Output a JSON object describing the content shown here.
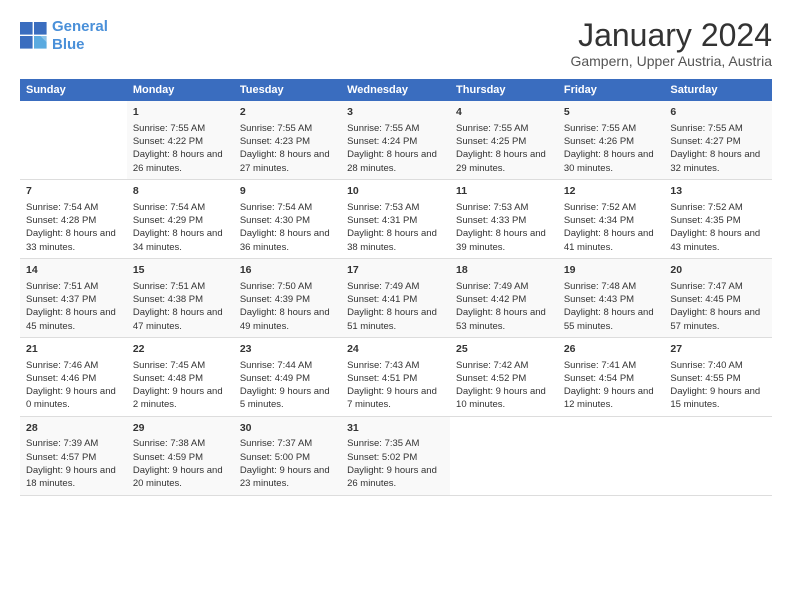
{
  "logo": {
    "line1": "General",
    "line2": "Blue"
  },
  "title": "January 2024",
  "location": "Gampern, Upper Austria, Austria",
  "days_of_week": [
    "Sunday",
    "Monday",
    "Tuesday",
    "Wednesday",
    "Thursday",
    "Friday",
    "Saturday"
  ],
  "weeks": [
    [
      {
        "day": "",
        "sunrise": "",
        "sunset": "",
        "daylight": ""
      },
      {
        "day": "1",
        "sunrise": "7:55 AM",
        "sunset": "4:22 PM",
        "daylight": "8 hours and 26 minutes."
      },
      {
        "day": "2",
        "sunrise": "7:55 AM",
        "sunset": "4:23 PM",
        "daylight": "8 hours and 27 minutes."
      },
      {
        "day": "3",
        "sunrise": "7:55 AM",
        "sunset": "4:24 PM",
        "daylight": "8 hours and 28 minutes."
      },
      {
        "day": "4",
        "sunrise": "7:55 AM",
        "sunset": "4:25 PM",
        "daylight": "8 hours and 29 minutes."
      },
      {
        "day": "5",
        "sunrise": "7:55 AM",
        "sunset": "4:26 PM",
        "daylight": "8 hours and 30 minutes."
      },
      {
        "day": "6",
        "sunrise": "7:55 AM",
        "sunset": "4:27 PM",
        "daylight": "8 hours and 32 minutes."
      }
    ],
    [
      {
        "day": "7",
        "sunrise": "7:54 AM",
        "sunset": "4:28 PM",
        "daylight": "8 hours and 33 minutes."
      },
      {
        "day": "8",
        "sunrise": "7:54 AM",
        "sunset": "4:29 PM",
        "daylight": "8 hours and 34 minutes."
      },
      {
        "day": "9",
        "sunrise": "7:54 AM",
        "sunset": "4:30 PM",
        "daylight": "8 hours and 36 minutes."
      },
      {
        "day": "10",
        "sunrise": "7:53 AM",
        "sunset": "4:31 PM",
        "daylight": "8 hours and 38 minutes."
      },
      {
        "day": "11",
        "sunrise": "7:53 AM",
        "sunset": "4:33 PM",
        "daylight": "8 hours and 39 minutes."
      },
      {
        "day": "12",
        "sunrise": "7:52 AM",
        "sunset": "4:34 PM",
        "daylight": "8 hours and 41 minutes."
      },
      {
        "day": "13",
        "sunrise": "7:52 AM",
        "sunset": "4:35 PM",
        "daylight": "8 hours and 43 minutes."
      }
    ],
    [
      {
        "day": "14",
        "sunrise": "7:51 AM",
        "sunset": "4:37 PM",
        "daylight": "8 hours and 45 minutes."
      },
      {
        "day": "15",
        "sunrise": "7:51 AM",
        "sunset": "4:38 PM",
        "daylight": "8 hours and 47 minutes."
      },
      {
        "day": "16",
        "sunrise": "7:50 AM",
        "sunset": "4:39 PM",
        "daylight": "8 hours and 49 minutes."
      },
      {
        "day": "17",
        "sunrise": "7:49 AM",
        "sunset": "4:41 PM",
        "daylight": "8 hours and 51 minutes."
      },
      {
        "day": "18",
        "sunrise": "7:49 AM",
        "sunset": "4:42 PM",
        "daylight": "8 hours and 53 minutes."
      },
      {
        "day": "19",
        "sunrise": "7:48 AM",
        "sunset": "4:43 PM",
        "daylight": "8 hours and 55 minutes."
      },
      {
        "day": "20",
        "sunrise": "7:47 AM",
        "sunset": "4:45 PM",
        "daylight": "8 hours and 57 minutes."
      }
    ],
    [
      {
        "day": "21",
        "sunrise": "7:46 AM",
        "sunset": "4:46 PM",
        "daylight": "9 hours and 0 minutes."
      },
      {
        "day": "22",
        "sunrise": "7:45 AM",
        "sunset": "4:48 PM",
        "daylight": "9 hours and 2 minutes."
      },
      {
        "day": "23",
        "sunrise": "7:44 AM",
        "sunset": "4:49 PM",
        "daylight": "9 hours and 5 minutes."
      },
      {
        "day": "24",
        "sunrise": "7:43 AM",
        "sunset": "4:51 PM",
        "daylight": "9 hours and 7 minutes."
      },
      {
        "day": "25",
        "sunrise": "7:42 AM",
        "sunset": "4:52 PM",
        "daylight": "9 hours and 10 minutes."
      },
      {
        "day": "26",
        "sunrise": "7:41 AM",
        "sunset": "4:54 PM",
        "daylight": "9 hours and 12 minutes."
      },
      {
        "day": "27",
        "sunrise": "7:40 AM",
        "sunset": "4:55 PM",
        "daylight": "9 hours and 15 minutes."
      }
    ],
    [
      {
        "day": "28",
        "sunrise": "7:39 AM",
        "sunset": "4:57 PM",
        "daylight": "9 hours and 18 minutes."
      },
      {
        "day": "29",
        "sunrise": "7:38 AM",
        "sunset": "4:59 PM",
        "daylight": "9 hours and 20 minutes."
      },
      {
        "day": "30",
        "sunrise": "7:37 AM",
        "sunset": "5:00 PM",
        "daylight": "9 hours and 23 minutes."
      },
      {
        "day": "31",
        "sunrise": "7:35 AM",
        "sunset": "5:02 PM",
        "daylight": "9 hours and 26 minutes."
      },
      {
        "day": "",
        "sunrise": "",
        "sunset": "",
        "daylight": ""
      },
      {
        "day": "",
        "sunrise": "",
        "sunset": "",
        "daylight": ""
      },
      {
        "day": "",
        "sunrise": "",
        "sunset": "",
        "daylight": ""
      }
    ]
  ],
  "labels": {
    "sunrise": "Sunrise:",
    "sunset": "Sunset:",
    "daylight": "Daylight:"
  }
}
